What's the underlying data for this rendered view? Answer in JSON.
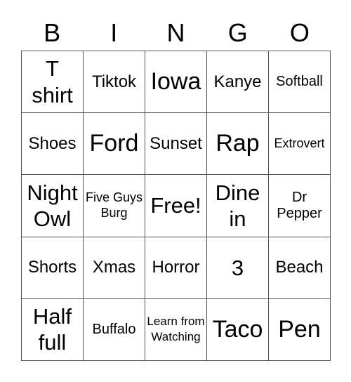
{
  "header": [
    "B",
    "I",
    "N",
    "G",
    "O"
  ],
  "cells": [
    {
      "text": "T shirt",
      "size": "l"
    },
    {
      "text": "Tiktok",
      "size": "m"
    },
    {
      "text": "Iowa",
      "size": "xl"
    },
    {
      "text": "Kanye",
      "size": "m"
    },
    {
      "text": "Softball",
      "size": "s"
    },
    {
      "text": "Shoes",
      "size": "m"
    },
    {
      "text": "Ford",
      "size": "xl"
    },
    {
      "text": "Sunset",
      "size": "m"
    },
    {
      "text": "Rap",
      "size": "xl"
    },
    {
      "text": "Extrovert",
      "size": "xs"
    },
    {
      "text": "Night Owl",
      "size": "l"
    },
    {
      "text": "Five Guys Burg",
      "size": "xs"
    },
    {
      "text": "Free!",
      "size": "l"
    },
    {
      "text": "Dine in",
      "size": "l"
    },
    {
      "text": "Dr Pepper",
      "size": "s"
    },
    {
      "text": "Shorts",
      "size": "m"
    },
    {
      "text": "Xmas",
      "size": "m"
    },
    {
      "text": "Horror",
      "size": "m"
    },
    {
      "text": "3",
      "size": "l"
    },
    {
      "text": "Beach",
      "size": "m"
    },
    {
      "text": "Half full",
      "size": "l"
    },
    {
      "text": "Buffalo",
      "size": "s"
    },
    {
      "text": "Learn from Watching",
      "size": "xxs"
    },
    {
      "text": "Taco",
      "size": "xl"
    },
    {
      "text": "Pen",
      "size": "xl"
    }
  ]
}
